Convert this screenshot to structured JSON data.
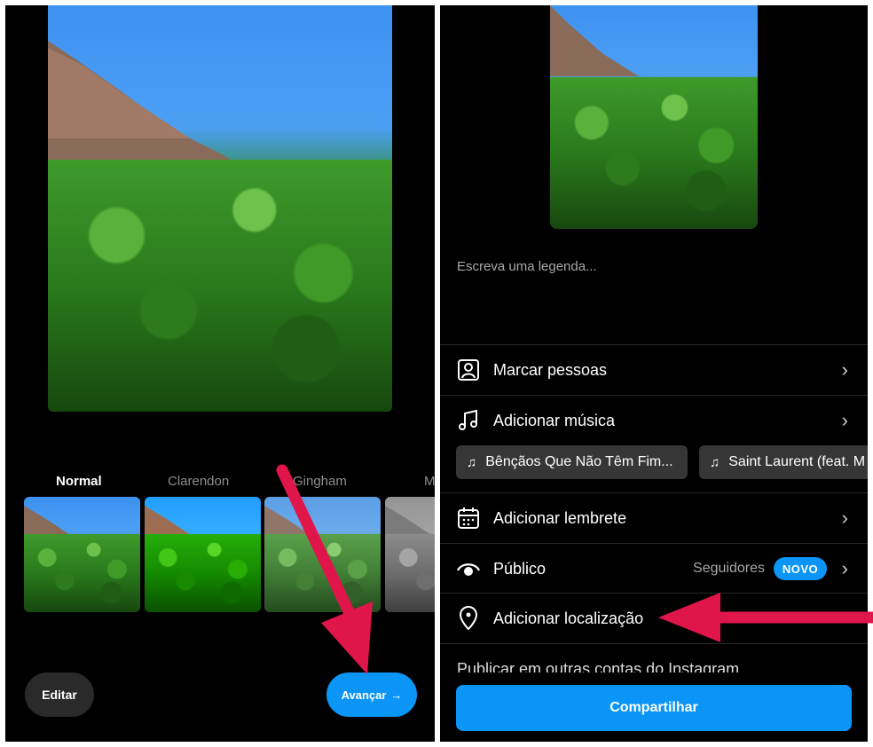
{
  "left_screen": {
    "filters": [
      {
        "label": "Normal",
        "active": true
      },
      {
        "label": "Clarendon",
        "active": false
      },
      {
        "label": "Gingham",
        "active": false
      },
      {
        "label": "M",
        "active": false
      }
    ],
    "edit_label": "Editar",
    "next_label": "Avançar",
    "next_icon": "→"
  },
  "right_screen": {
    "caption_placeholder": "Escreva uma legenda...",
    "rows": {
      "tag_people": "Marcar pessoas",
      "add_music": "Adicionar música",
      "add_reminder": "Adicionar lembrete",
      "audience": "Público",
      "audience_value": "Seguidores",
      "audience_badge": "NOVO",
      "add_location": "Adicionar localização"
    },
    "music_chips": [
      "Bênçãos Que Não Têm Fim...",
      "Saint Laurent (feat. M"
    ],
    "other_accounts": "Publicar em outras contas do Instagram",
    "share_label": "Compartilhar"
  },
  "colors": {
    "accent": "#0b95f6",
    "annotation_arrow": "#e0164a",
    "background": "#000000"
  }
}
